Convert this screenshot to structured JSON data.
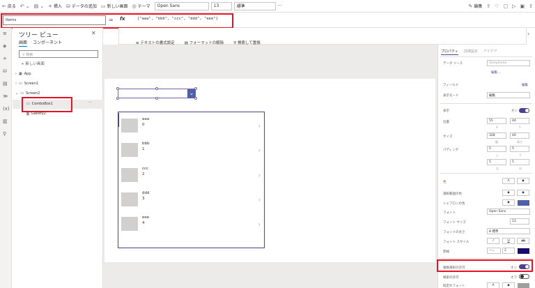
{
  "toolbar": {
    "back": "戻る",
    "insert": "挿入",
    "add_data": "データの追加",
    "new_screen": "新しい画面",
    "theme": "テーマ",
    "font": "Open Sans",
    "font_size": "13",
    "weight": "標準",
    "edit": "編集",
    "more": "···"
  },
  "formula": {
    "property": "Items",
    "eq": "=",
    "fx": "fx",
    "value": "[\"aaa\", \"bbb\", \"ccc\", \"ddd\", \"eee\"]"
  },
  "format": {
    "text_format": "テキストの書式設定",
    "remove_format": "フォーマットの解除",
    "find_replace": "検索して置換"
  },
  "tree": {
    "title": "ツリー ビュー",
    "tab_screens": "画面",
    "tab_components": "コンポーネント",
    "search_placeholder": "検索",
    "new_screen": "新しい画面",
    "nodes": [
      "App",
      "Screen1",
      "Screen2",
      "ComboBox1",
      "Gallery2"
    ],
    "more": "···"
  },
  "gallery": [
    {
      "title": "aaa",
      "sub": "0"
    },
    {
      "title": "bbb",
      "sub": "1"
    },
    {
      "title": "ccc",
      "sub": "2"
    },
    {
      "title": "ddd",
      "sub": "3"
    },
    {
      "title": "eee",
      "sub": "4"
    }
  ],
  "props": {
    "tabs": [
      "プロパティ",
      "詳細設定",
      "アイデア"
    ],
    "data_source": "データ ソース",
    "data_source_val": "Sampleone",
    "edit_link": "編集...",
    "fields": "フィールド",
    "fields_edit": "編集",
    "display_mode": "表示モード",
    "display_mode_val": "編集",
    "visible": "表示",
    "visible_val": "オン",
    "position": "位置",
    "pos_x": "55",
    "pos_y": "44",
    "x": "X",
    "y": "Y",
    "size": "サイズ",
    "width": "328",
    "height": "40",
    "w": "幅",
    "h": "高さ",
    "padding": "パディング",
    "pad_vals": [
      "5",
      "5",
      "5",
      "5"
    ],
    "pad_labels": [
      "上",
      "下",
      "左",
      "右"
    ],
    "color": "色",
    "selected_color": "選択範囲の色",
    "chevron_color": "シェブロンの色",
    "font": "フォント",
    "font_val": "Open Sans",
    "font_size": "フォント サイズ",
    "font_size_val": "13",
    "font_weight": "フォントの太さ",
    "font_weight_val": "B 標準",
    "font_style": "フォント スタイル",
    "border": "罫線",
    "border_val": "2",
    "multi_select": "複数選択の許可",
    "multi_select_val": "オン",
    "search_allow": "検索の許可",
    "search_allow_val": "オフ",
    "default_color": "既定のフォント"
  },
  "colors": {
    "accent": "#4f3f8f",
    "red": "#e81123",
    "chevron": "#4f5fa8"
  }
}
